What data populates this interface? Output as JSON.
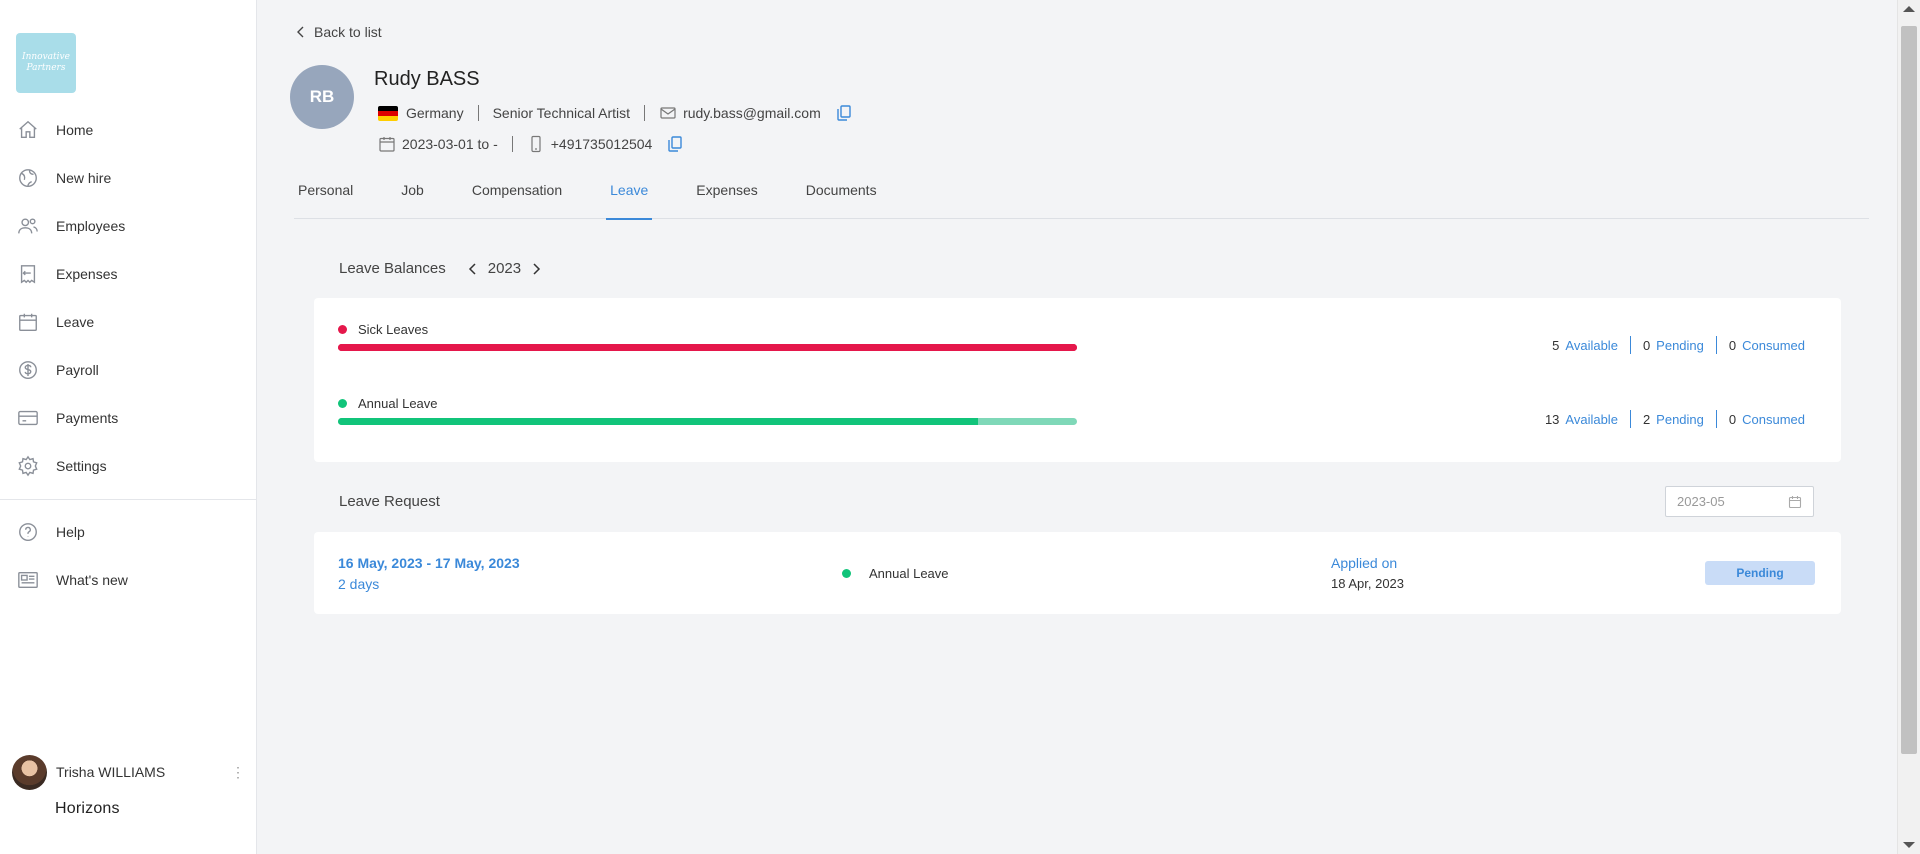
{
  "sidebar": {
    "logo_text": "Innovative Partners",
    "nav_items": [
      {
        "label": "Home",
        "icon": "home-icon"
      },
      {
        "label": "New hire",
        "icon": "globe-icon"
      },
      {
        "label": "Employees",
        "icon": "users-icon"
      },
      {
        "label": "Expenses",
        "icon": "receipt-icon"
      },
      {
        "label": "Leave",
        "icon": "calendar-icon"
      },
      {
        "label": "Payroll",
        "icon": "dollar-icon"
      },
      {
        "label": "Payments",
        "icon": "credit-card-icon"
      },
      {
        "label": "Settings",
        "icon": "gear-icon"
      }
    ],
    "secondary_items": [
      {
        "label": "Help",
        "icon": "help-icon"
      },
      {
        "label": "What's new",
        "icon": "newspaper-icon"
      }
    ],
    "user_name": "Trisha WILLIAMS",
    "brand": "Horizons"
  },
  "main": {
    "back_label": "Back to list",
    "employee": {
      "initials": "RB",
      "name": "Rudy BASS",
      "country": "Germany",
      "job_title": "Senior Technical Artist",
      "email": "rudy.bass@gmail.com",
      "period": "2023-03-01 to -",
      "phone": "+491735012504"
    },
    "tabs": [
      "Personal",
      "Job",
      "Compensation",
      "Leave",
      "Expenses",
      "Documents"
    ],
    "active_tab": "Leave",
    "leave_balances": {
      "title": "Leave Balances",
      "year": "2023",
      "items": [
        {
          "name": "Sick Leaves",
          "color": "#e5174b",
          "track_color": "#e5174b",
          "available": "5",
          "pending": "0",
          "consumed": "0",
          "available_fraction": 1.0
        },
        {
          "name": "Annual Leave",
          "color": "#11c47a",
          "track_color": "#7fd8b8",
          "available": "13",
          "pending": "2",
          "consumed": "0",
          "available_fraction": 0.866
        }
      ],
      "labels": {
        "available": "Available",
        "pending": "Pending",
        "consumed": "Consumed"
      }
    },
    "leave_request": {
      "title": "Leave Request",
      "month_filter": "2023-05",
      "requests": [
        {
          "dates": "16 May, 2023 - 17 May, 2023",
          "duration": "2 days",
          "type": "Annual Leave",
          "type_color": "#11c47a",
          "applied_label": "Applied on",
          "applied_date": "18 Apr, 2023",
          "status": "Pending"
        }
      ]
    }
  }
}
